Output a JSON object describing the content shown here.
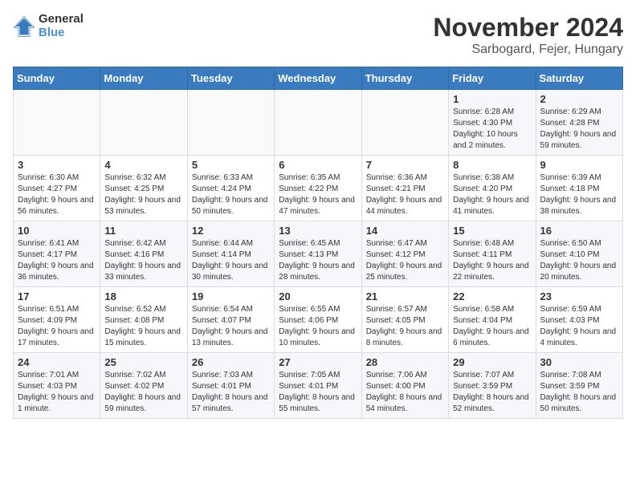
{
  "logo": {
    "text_general": "General",
    "text_blue": "Blue"
  },
  "title": {
    "month_year": "November 2024",
    "location": "Sarbogard, Fejer, Hungary"
  },
  "headers": [
    "Sunday",
    "Monday",
    "Tuesday",
    "Wednesday",
    "Thursday",
    "Friday",
    "Saturday"
  ],
  "weeks": [
    [
      {
        "day": "",
        "sunrise": "",
        "sunset": "",
        "daylight": ""
      },
      {
        "day": "",
        "sunrise": "",
        "sunset": "",
        "daylight": ""
      },
      {
        "day": "",
        "sunrise": "",
        "sunset": "",
        "daylight": ""
      },
      {
        "day": "",
        "sunrise": "",
        "sunset": "",
        "daylight": ""
      },
      {
        "day": "",
        "sunrise": "",
        "sunset": "",
        "daylight": ""
      },
      {
        "day": "1",
        "sunrise": "Sunrise: 6:28 AM",
        "sunset": "Sunset: 4:30 PM",
        "daylight": "Daylight: 10 hours and 2 minutes."
      },
      {
        "day": "2",
        "sunrise": "Sunrise: 6:29 AM",
        "sunset": "Sunset: 4:28 PM",
        "daylight": "Daylight: 9 hours and 59 minutes."
      }
    ],
    [
      {
        "day": "3",
        "sunrise": "Sunrise: 6:30 AM",
        "sunset": "Sunset: 4:27 PM",
        "daylight": "Daylight: 9 hours and 56 minutes."
      },
      {
        "day": "4",
        "sunrise": "Sunrise: 6:32 AM",
        "sunset": "Sunset: 4:25 PM",
        "daylight": "Daylight: 9 hours and 53 minutes."
      },
      {
        "day": "5",
        "sunrise": "Sunrise: 6:33 AM",
        "sunset": "Sunset: 4:24 PM",
        "daylight": "Daylight: 9 hours and 50 minutes."
      },
      {
        "day": "6",
        "sunrise": "Sunrise: 6:35 AM",
        "sunset": "Sunset: 4:22 PM",
        "daylight": "Daylight: 9 hours and 47 minutes."
      },
      {
        "day": "7",
        "sunrise": "Sunrise: 6:36 AM",
        "sunset": "Sunset: 4:21 PM",
        "daylight": "Daylight: 9 hours and 44 minutes."
      },
      {
        "day": "8",
        "sunrise": "Sunrise: 6:38 AM",
        "sunset": "Sunset: 4:20 PM",
        "daylight": "Daylight: 9 hours and 41 minutes."
      },
      {
        "day": "9",
        "sunrise": "Sunrise: 6:39 AM",
        "sunset": "Sunset: 4:18 PM",
        "daylight": "Daylight: 9 hours and 38 minutes."
      }
    ],
    [
      {
        "day": "10",
        "sunrise": "Sunrise: 6:41 AM",
        "sunset": "Sunset: 4:17 PM",
        "daylight": "Daylight: 9 hours and 36 minutes."
      },
      {
        "day": "11",
        "sunrise": "Sunrise: 6:42 AM",
        "sunset": "Sunset: 4:16 PM",
        "daylight": "Daylight: 9 hours and 33 minutes."
      },
      {
        "day": "12",
        "sunrise": "Sunrise: 6:44 AM",
        "sunset": "Sunset: 4:14 PM",
        "daylight": "Daylight: 9 hours and 30 minutes."
      },
      {
        "day": "13",
        "sunrise": "Sunrise: 6:45 AM",
        "sunset": "Sunset: 4:13 PM",
        "daylight": "Daylight: 9 hours and 28 minutes."
      },
      {
        "day": "14",
        "sunrise": "Sunrise: 6:47 AM",
        "sunset": "Sunset: 4:12 PM",
        "daylight": "Daylight: 9 hours and 25 minutes."
      },
      {
        "day": "15",
        "sunrise": "Sunrise: 6:48 AM",
        "sunset": "Sunset: 4:11 PM",
        "daylight": "Daylight: 9 hours and 22 minutes."
      },
      {
        "day": "16",
        "sunrise": "Sunrise: 6:50 AM",
        "sunset": "Sunset: 4:10 PM",
        "daylight": "Daylight: 9 hours and 20 minutes."
      }
    ],
    [
      {
        "day": "17",
        "sunrise": "Sunrise: 6:51 AM",
        "sunset": "Sunset: 4:09 PM",
        "daylight": "Daylight: 9 hours and 17 minutes."
      },
      {
        "day": "18",
        "sunrise": "Sunrise: 6:52 AM",
        "sunset": "Sunset: 4:08 PM",
        "daylight": "Daylight: 9 hours and 15 minutes."
      },
      {
        "day": "19",
        "sunrise": "Sunrise: 6:54 AM",
        "sunset": "Sunset: 4:07 PM",
        "daylight": "Daylight: 9 hours and 13 minutes."
      },
      {
        "day": "20",
        "sunrise": "Sunrise: 6:55 AM",
        "sunset": "Sunset: 4:06 PM",
        "daylight": "Daylight: 9 hours and 10 minutes."
      },
      {
        "day": "21",
        "sunrise": "Sunrise: 6:57 AM",
        "sunset": "Sunset: 4:05 PM",
        "daylight": "Daylight: 9 hours and 8 minutes."
      },
      {
        "day": "22",
        "sunrise": "Sunrise: 6:58 AM",
        "sunset": "Sunset: 4:04 PM",
        "daylight": "Daylight: 9 hours and 6 minutes."
      },
      {
        "day": "23",
        "sunrise": "Sunrise: 6:59 AM",
        "sunset": "Sunset: 4:03 PM",
        "daylight": "Daylight: 9 hours and 4 minutes."
      }
    ],
    [
      {
        "day": "24",
        "sunrise": "Sunrise: 7:01 AM",
        "sunset": "Sunset: 4:03 PM",
        "daylight": "Daylight: 9 hours and 1 minute."
      },
      {
        "day": "25",
        "sunrise": "Sunrise: 7:02 AM",
        "sunset": "Sunset: 4:02 PM",
        "daylight": "Daylight: 8 hours and 59 minutes."
      },
      {
        "day": "26",
        "sunrise": "Sunrise: 7:03 AM",
        "sunset": "Sunset: 4:01 PM",
        "daylight": "Daylight: 8 hours and 57 minutes."
      },
      {
        "day": "27",
        "sunrise": "Sunrise: 7:05 AM",
        "sunset": "Sunset: 4:01 PM",
        "daylight": "Daylight: 8 hours and 55 minutes."
      },
      {
        "day": "28",
        "sunrise": "Sunrise: 7:06 AM",
        "sunset": "Sunset: 4:00 PM",
        "daylight": "Daylight: 8 hours and 54 minutes."
      },
      {
        "day": "29",
        "sunrise": "Sunrise: 7:07 AM",
        "sunset": "Sunset: 3:59 PM",
        "daylight": "Daylight: 8 hours and 52 minutes."
      },
      {
        "day": "30",
        "sunrise": "Sunrise: 7:08 AM",
        "sunset": "Sunset: 3:59 PM",
        "daylight": "Daylight: 8 hours and 50 minutes."
      }
    ]
  ]
}
